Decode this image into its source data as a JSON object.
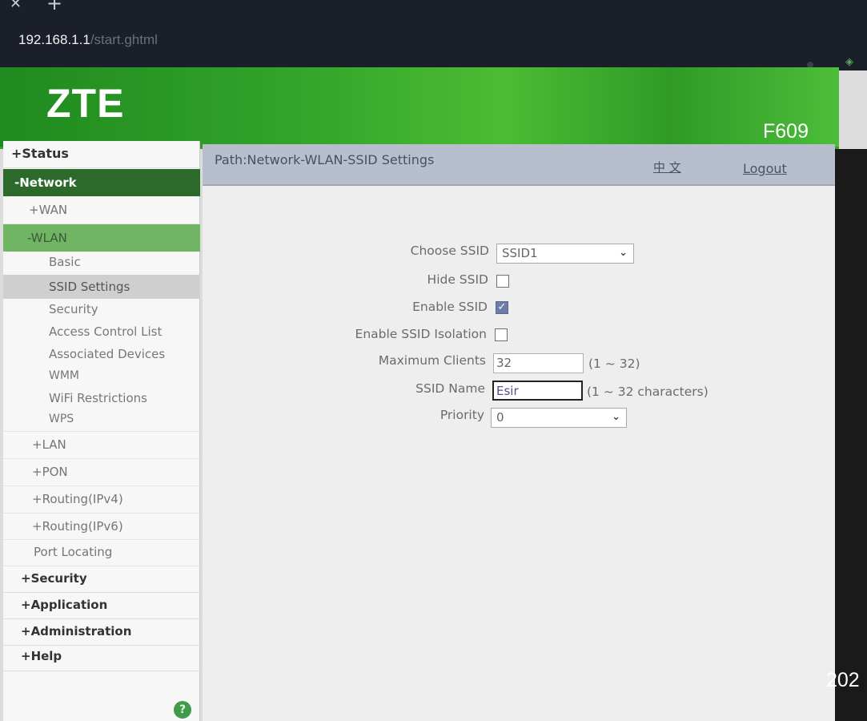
{
  "browser": {
    "url_host": "192.168.1.1",
    "url_path": "/start.ghtml",
    "close_icon": "✕",
    "new_tab_icon": "+"
  },
  "header": {
    "logo": "ZTE",
    "model": "F609",
    "brand_color": "#33a32a"
  },
  "sidebar": {
    "items": [
      {
        "label": "+Status"
      },
      {
        "label": "-Network"
      },
      {
        "label": "+WAN"
      },
      {
        "label": "-WLAN"
      },
      {
        "label": "Basic"
      },
      {
        "label": "SSID Settings"
      },
      {
        "label": "Security"
      },
      {
        "label": "Access Control List"
      },
      {
        "label": "Associated Devices"
      },
      {
        "label": "WMM"
      },
      {
        "label": "WiFi Restrictions"
      },
      {
        "label": "WPS"
      },
      {
        "label": "+LAN"
      },
      {
        "label": "+PON"
      },
      {
        "label": "+Routing(IPv4)"
      },
      {
        "label": "+Routing(IPv6)"
      },
      {
        "label": "Port Locating"
      },
      {
        "label": "+Security"
      },
      {
        "label": "+Application"
      },
      {
        "label": "+Administration"
      },
      {
        "label": "+Help"
      }
    ],
    "help_icon": "?"
  },
  "main": {
    "path": "Path:Network-WLAN-SSID Settings",
    "lang_link": "中 文",
    "logout": "Logout",
    "form": {
      "choose_ssid_label": "Choose SSID",
      "choose_ssid_value": "SSID1",
      "hide_ssid_label": "Hide SSID",
      "hide_ssid_checked": false,
      "enable_ssid_label": "Enable SSID",
      "enable_ssid_checked": true,
      "isolation_label": "Enable SSID Isolation",
      "isolation_checked": false,
      "max_clients_label": "Maximum Clients",
      "max_clients_value": "32",
      "max_clients_hint": "(1 ~ 32)",
      "ssid_name_label": "SSID Name",
      "ssid_name_value": "Esir",
      "ssid_name_hint": "(1 ~ 32 characters)",
      "priority_label": "Priority",
      "priority_value": "0",
      "check_mark": "✓",
      "chevron": "⌄"
    }
  },
  "overlay": {
    "year_fragment": "202"
  }
}
